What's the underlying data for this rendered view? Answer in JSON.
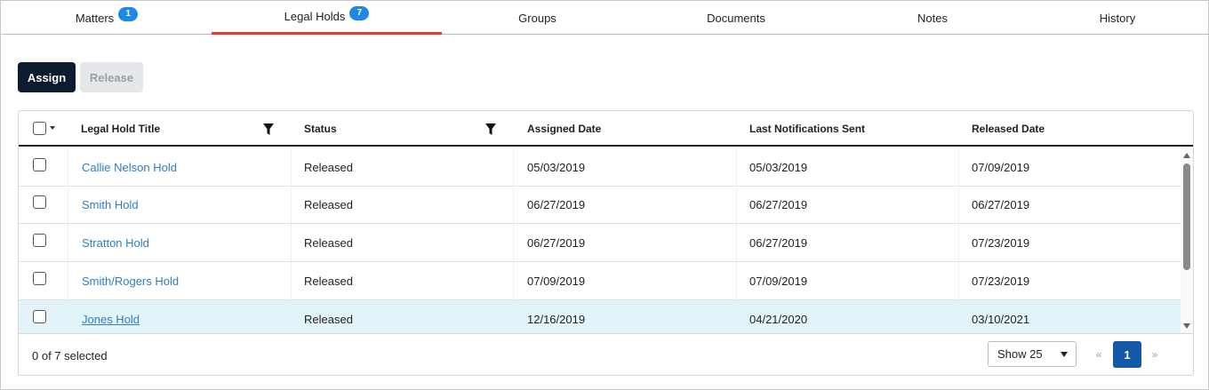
{
  "tabs": [
    {
      "label": "Matters",
      "badge": "1"
    },
    {
      "label": "Legal Holds",
      "badge": "7"
    },
    {
      "label": "Groups"
    },
    {
      "label": "Documents"
    },
    {
      "label": "Notes"
    },
    {
      "label": "History"
    }
  ],
  "active_tab": "Legal Holds",
  "toolbar": {
    "assign_label": "Assign",
    "release_label": "Release"
  },
  "table": {
    "columns": [
      "Legal Hold Title",
      "Status",
      "Assigned Date",
      "Last Notifications Sent",
      "Released Date"
    ],
    "rows": [
      {
        "title": "Callie Nelson Hold",
        "status": "Released",
        "assigned": "05/03/2019",
        "last_notified": "05/03/2019",
        "released": "07/09/2019"
      },
      {
        "title": "Smith Hold",
        "status": "Released",
        "assigned": "06/27/2019",
        "last_notified": "06/27/2019",
        "released": "06/27/2019"
      },
      {
        "title": "Stratton Hold",
        "status": "Released",
        "assigned": "06/27/2019",
        "last_notified": "06/27/2019",
        "released": "07/23/2019"
      },
      {
        "title": "Smith/Rogers Hold",
        "status": "Released",
        "assigned": "07/09/2019",
        "last_notified": "07/09/2019",
        "released": "07/23/2019"
      },
      {
        "title": "Jones Hold",
        "status": "Released",
        "assigned": "12/16/2019",
        "last_notified": "04/21/2020",
        "released": "03/10/2021"
      }
    ],
    "highlighted_row": "Jones Hold"
  },
  "footer": {
    "selection_text": "0 of 7 selected",
    "page_size_label": "Show 25",
    "prev_label": "«",
    "current_page": "1",
    "next_label": "»"
  },
  "colors": {
    "primary_button": "#0d1b2e",
    "active_tab_underline": "#e53935",
    "badge": "#1e88e5",
    "link": "#2e7fc1",
    "current_page": "#1557a8",
    "row_highlight": "#e3f3fa"
  }
}
